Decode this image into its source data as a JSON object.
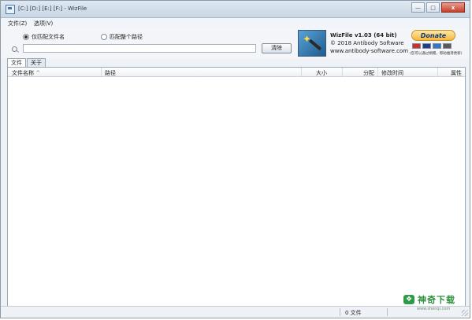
{
  "window": {
    "title": "[C:] [D:] [E:] [F:] - WizFile",
    "min_label": "—",
    "max_label": "□",
    "close_label": "x"
  },
  "menu": {
    "file": "文件(Z)",
    "options": "选项(V)"
  },
  "search": {
    "radio_filename": "仅匹配文件名",
    "radio_fullpath": "匹配整个路径",
    "input_value": "",
    "clear_label": "清除"
  },
  "app_info": {
    "version": "WizFile v1.03 (64 bit)",
    "copyright": "© 2018 Antibody Software",
    "website": "www.antibody-software.com"
  },
  "donate": {
    "label": "Donate",
    "note": "(您可以通过捐赠，帮助维持更新)",
    "card_colors": [
      "#c9322a",
      "#1a3f8f",
      "#2b7bc4",
      "#5a5a5a"
    ]
  },
  "tabs": [
    {
      "label": "文件"
    },
    {
      "label": "关于"
    }
  ],
  "table": {
    "columns": [
      "文件名称",
      "路径",
      "大小",
      "分配",
      "修改时间",
      "属性"
    ],
    "sort_indicator": "^"
  },
  "status": {
    "count_text": "0 文件"
  },
  "watermark": {
    "text": "神奇下载",
    "sub": "www.shenqi.com"
  },
  "colors": {
    "accent": "#2f9a48",
    "title_bg": "#dfe8f2",
    "donate": "#f6b73c"
  }
}
